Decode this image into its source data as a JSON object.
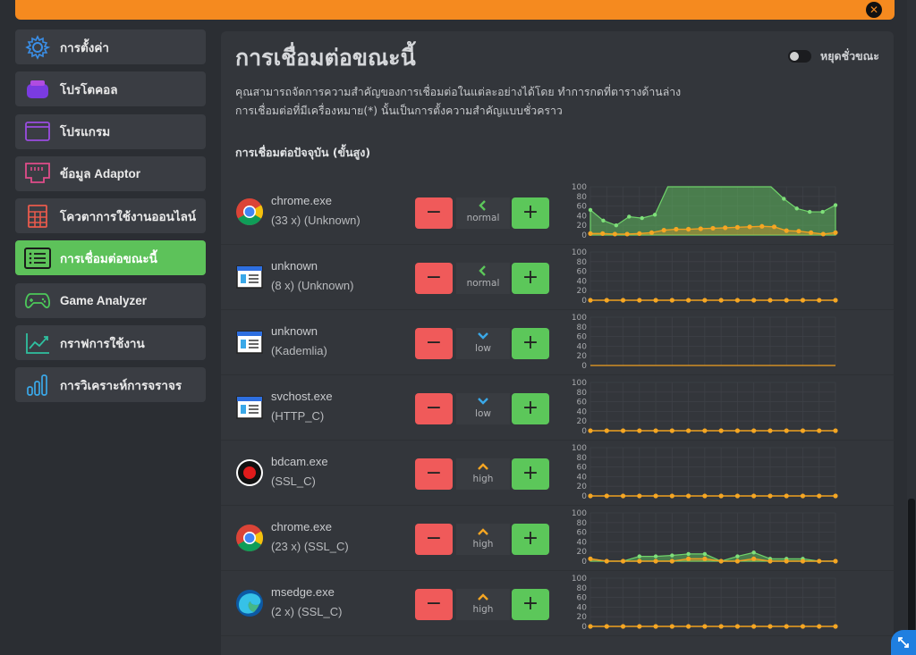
{
  "sidebar": {
    "items": [
      {
        "label": "การตั้งค่า",
        "icon": "gear-icon",
        "active": false
      },
      {
        "label": "โปรโตคอล",
        "icon": "protocol-icon",
        "active": false
      },
      {
        "label": "โปรแกรม",
        "icon": "window-icon",
        "active": false
      },
      {
        "label": "ข้อมูล Adaptor",
        "icon": "network-port-icon",
        "active": false
      },
      {
        "label": "โควตาการใช้งานออนไลน์",
        "icon": "calculator-icon",
        "active": false
      },
      {
        "label": "การเชื่อมต่อขณะนี้",
        "icon": "list-icon",
        "active": true
      },
      {
        "label": "Game Analyzer",
        "icon": "gamepad-icon",
        "active": false
      },
      {
        "label": "กราฟการใช้งาน",
        "icon": "line-chart-icon",
        "active": false
      },
      {
        "label": "การวิเคราะห์การจราจร",
        "icon": "bar-chart-icon",
        "active": false
      }
    ]
  },
  "panel": {
    "title": "การเชื่อมต่อขณะนี้",
    "pause_label": "หยุดชั่วขณะ",
    "desc_line1": "คุณสามารถจัดการความสำคัญของการเชื่อมต่อในแต่ละอย่างได้โดย ทำการกดที่ตารางด้านล่าง",
    "desc_line2": "การเชื่อมต่อที่มีเครื่องหมาย(*) นั้นเป็นการตั้งความสำคัญแบบชั่วคราว",
    "section_title": "การเชื่อมต่อปัจจุบัน (ขั้นสูง)"
  },
  "colors": {
    "accent_orange": "#f58a1f",
    "active_green": "#5dc25a",
    "minus_red": "#f05a5a",
    "line_orange": "#f0a020",
    "area_green": "#5cb85c"
  },
  "chart_axis": {
    "ymax": 100,
    "ticks": [
      "100",
      "80",
      "60",
      "40",
      "20",
      "0"
    ]
  },
  "connections": [
    {
      "name": "chrome.exe",
      "info": "(33 x) (Unknown)",
      "icon": "chrome-icon",
      "priority": "normal",
      "arrow": "left",
      "green": [
        52,
        30,
        20,
        38,
        35,
        42,
        100,
        100,
        100,
        100,
        100,
        100,
        100,
        100,
        100,
        75,
        55,
        48,
        48,
        62
      ],
      "orange": [
        3,
        3,
        2,
        2,
        3,
        5,
        10,
        12,
        12,
        13,
        14,
        15,
        16,
        17,
        18,
        17,
        9,
        8,
        5,
        2,
        5
      ]
    },
    {
      "name": "unknown",
      "info": "(8 x) (Unknown)",
      "icon": "app-window-icon",
      "priority": "normal",
      "arrow": "left",
      "green": [],
      "orange": [
        0,
        0,
        0,
        0,
        0,
        0,
        0,
        0,
        0,
        0,
        0,
        0,
        0,
        0,
        0,
        0
      ]
    },
    {
      "name": "unknown",
      "info": "(Kademlia)",
      "icon": "app-window-icon",
      "priority": "low",
      "arrow": "down",
      "green": [],
      "orange": []
    },
    {
      "name": "svchost.exe",
      "info": "(HTTP_C)",
      "icon": "app-window-icon",
      "priority": "low",
      "arrow": "down",
      "green": [],
      "orange": [
        0,
        0,
        0,
        0,
        0,
        0,
        0,
        0,
        0,
        0,
        0,
        0,
        0,
        0,
        0,
        0
      ]
    },
    {
      "name": "bdcam.exe",
      "info": "(SSL_C)",
      "icon": "record-icon",
      "priority": "high",
      "arrow": "up",
      "green": [],
      "orange": [
        0,
        0,
        0,
        0,
        0,
        0,
        0,
        0,
        0,
        0,
        0,
        0,
        0,
        0,
        0,
        0
      ]
    },
    {
      "name": "chrome.exe",
      "info": "(23 x) (SSL_C)",
      "icon": "chrome-icon",
      "priority": "high",
      "arrow": "up",
      "green": [
        5,
        0,
        0,
        10,
        10,
        12,
        15,
        15,
        0,
        10,
        18,
        5,
        5,
        5,
        0,
        0
      ],
      "orange": [
        5,
        0,
        0,
        0,
        0,
        0,
        5,
        5,
        0,
        0,
        5,
        0,
        0,
        0,
        0,
        0
      ]
    },
    {
      "name": "msedge.exe",
      "info": "(2 x) (SSL_C)",
      "icon": "edge-icon",
      "priority": "high",
      "arrow": "up",
      "green": [],
      "orange": [
        0,
        0,
        0,
        0,
        0,
        0,
        0,
        0,
        0,
        0,
        0,
        0,
        0,
        0,
        0,
        0
      ]
    }
  ]
}
